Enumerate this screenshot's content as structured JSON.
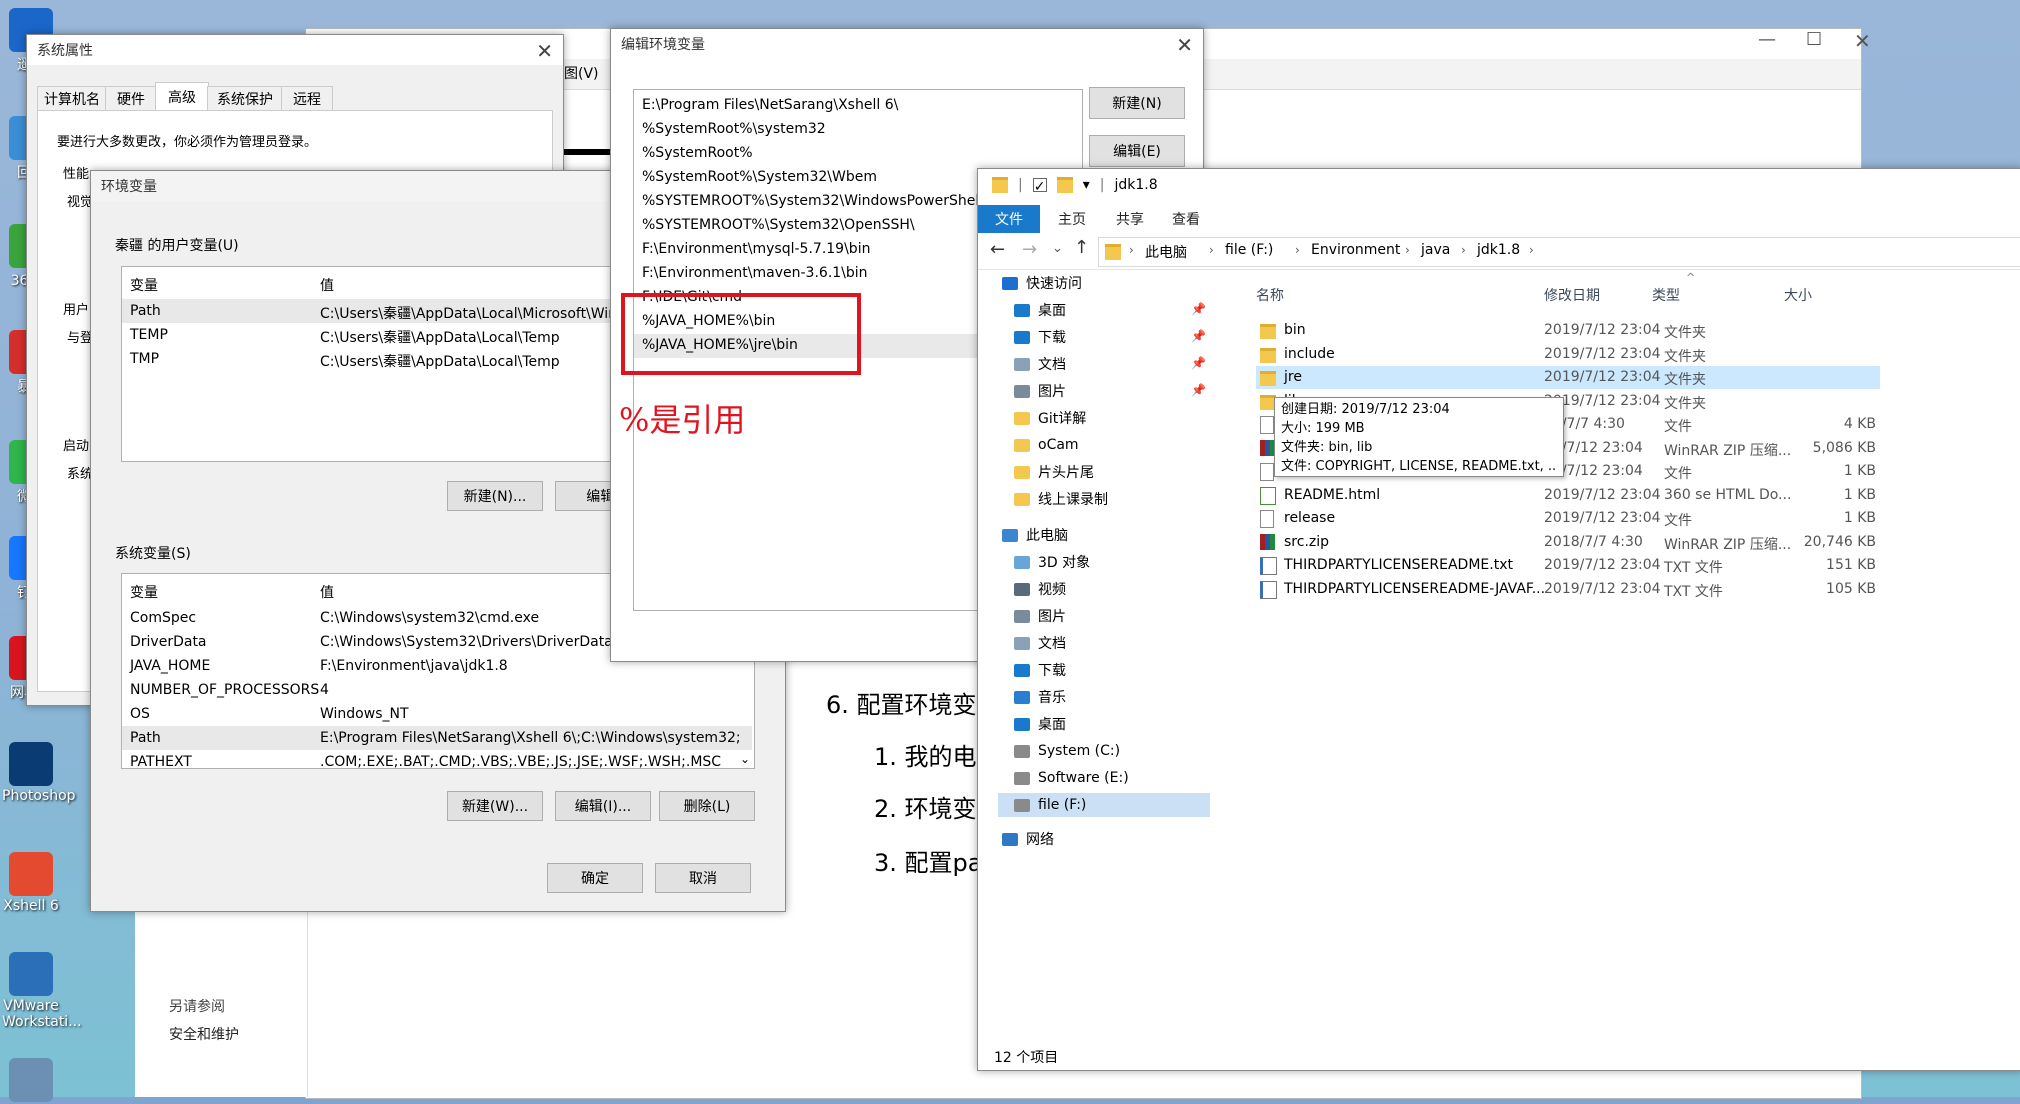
{
  "desktop": {
    "icons": [
      {
        "label": "遥控",
        "color": "#1b66c9"
      },
      {
        "label": "回收",
        "color": "#3b8ed6"
      },
      {
        "label": "360安",
        "color": "#3aa33c"
      },
      {
        "label": "暴风",
        "color": "#d62d2d"
      },
      {
        "label": "微信",
        "color": "#2fb54a"
      },
      {
        "label": "钉钉",
        "color": "#1677ff"
      },
      {
        "label": "网易云",
        "color": "#d8151f"
      },
      {
        "label": "Photoshop",
        "color": "#0b3b73"
      },
      {
        "label": "Xshell 6",
        "color": "#e34a2f"
      },
      {
        "label": "VMware Workstati...",
        "color": "#2a6fb7"
      },
      {
        "label": "",
        "color": "#6c8fb4"
      }
    ]
  },
  "sysprops": {
    "title": "系统属性",
    "tabs": [
      "计算机名",
      "硬件",
      "高级",
      "系统保护",
      "远程"
    ],
    "selected_tab": "高级",
    "admin_note": "要进行大多数更改，你必须作为管理员登录。",
    "perf_label": "性能",
    "perf_sub": "视觉",
    "user_label": "用户",
    "user_sub": "与登",
    "startup_label": "启动",
    "startup_sub": "系统"
  },
  "envvars": {
    "title": "环境变量",
    "user_group": "秦疆 的用户变量(U)",
    "col_var": "变量",
    "col_val": "值",
    "user_rows": [
      {
        "name": "Path",
        "value": "C:\\Users\\秦疆\\AppData\\Local\\Microsoft\\Windo"
      },
      {
        "name": "TEMP",
        "value": "C:\\Users\\秦疆\\AppData\\Local\\Temp"
      },
      {
        "name": "TMP",
        "value": "C:\\Users\\秦疆\\AppData\\Local\\Temp"
      }
    ],
    "user_new": "新建(N)...",
    "user_edit": "编辑(",
    "sys_group": "系统变量(S)",
    "sys_rows": [
      {
        "name": "ComSpec",
        "value": "C:\\Windows\\system32\\cmd.exe"
      },
      {
        "name": "DriverData",
        "value": "C:\\Windows\\System32\\Drivers\\DriverData"
      },
      {
        "name": "JAVA_HOME",
        "value": "F:\\Environment\\java\\jdk1.8"
      },
      {
        "name": "NUMBER_OF_PROCESSORS",
        "value": "4"
      },
      {
        "name": "OS",
        "value": "Windows_NT"
      },
      {
        "name": "Path",
        "value": "E:\\Program Files\\NetSarang\\Xshell 6\\;C:\\Windows\\system32;..."
      },
      {
        "name": "PATHEXT",
        "value": ".COM;.EXE;.BAT;.CMD;.VBS;.VBE;.JS;.JSE;.WSF;.WSH;.MSC"
      }
    ],
    "sys_new": "新建(W)...",
    "sys_edit": "编辑(I)...",
    "sys_delete": "删除(L)",
    "ok": "确定",
    "cancel": "取消"
  },
  "editenv": {
    "title": "编辑环境变量",
    "entries": [
      "E:\\Program Files\\NetSarang\\Xshell 6\\",
      "%SystemRoot%\\system32",
      "%SystemRoot%",
      "%SystemRoot%\\System32\\Wbem",
      "%SYSTEMROOT%\\System32\\WindowsPowerShell\\v",
      "%SYSTEMROOT%\\System32\\OpenSSH\\",
      "F:\\Environment\\mysql-5.7.19\\bin",
      "F:\\Environment\\maven-3.6.1\\bin",
      "F:\\IDE\\Git\\cmd",
      "%JAVA_HOME%\\bin",
      "%JAVA_HOME%\\jre\\bin"
    ],
    "new_btn": "新建(N)",
    "edit_btn": "编辑(E)",
    "annotation": "%是引用",
    "highlight_color": "#e0141e"
  },
  "bgdoc": {
    "menu_frag": "图(V)",
    "step_title": "6. 配置环境变",
    "steps": [
      "1. 我的电",
      "2. 环境变",
      "3. 配置pa"
    ],
    "see_also": "另请参阅",
    "security": "安全和维护"
  },
  "explorer": {
    "path_title": "jdk1.8",
    "ribbon_tabs": [
      "文件",
      "主页",
      "共享",
      "查看"
    ],
    "breadcrumb": [
      "此电脑",
      "file (F:)",
      "Environment",
      "java",
      "jdk1.8"
    ],
    "nav": [
      {
        "label": "快速访问",
        "icon": "star-icon",
        "pinned": false
      },
      {
        "label": "桌面",
        "icon": "desktop-icon",
        "pinned": true
      },
      {
        "label": "下载",
        "icon": "download-icon",
        "pinned": true
      },
      {
        "label": "文档",
        "icon": "document-icon",
        "pinned": true
      },
      {
        "label": "图片",
        "icon": "picture-icon",
        "pinned": true
      },
      {
        "label": "Git详解",
        "icon": "folder-icon",
        "pinned": false
      },
      {
        "label": "oCam",
        "icon": "folder-icon",
        "pinned": false
      },
      {
        "label": "片头片尾",
        "icon": "folder-icon",
        "pinned": false
      },
      {
        "label": "线上课录制",
        "icon": "folder-icon",
        "pinned": false
      },
      {
        "label": "此电脑",
        "icon": "computer-icon",
        "pinned": false
      },
      {
        "label": "3D 对象",
        "icon": "cube-icon",
        "pinned": false
      },
      {
        "label": "视频",
        "icon": "video-icon",
        "pinned": false
      },
      {
        "label": "图片",
        "icon": "picture-icon",
        "pinned": false
      },
      {
        "label": "文档",
        "icon": "document-icon",
        "pinned": false
      },
      {
        "label": "下载",
        "icon": "download-icon",
        "pinned": false
      },
      {
        "label": "音乐",
        "icon": "music-icon",
        "pinned": false
      },
      {
        "label": "桌面",
        "icon": "desktop-icon",
        "pinned": false
      },
      {
        "label": "System (C:)",
        "icon": "drive-icon",
        "pinned": false
      },
      {
        "label": "Software (E:)",
        "icon": "drive-icon",
        "pinned": false
      },
      {
        "label": "file (F:)",
        "icon": "drive-icon",
        "pinned": false
      },
      {
        "label": "网络",
        "icon": "network-icon",
        "pinned": false
      }
    ],
    "columns": [
      "名称",
      "修改日期",
      "类型",
      "大小"
    ],
    "files": [
      {
        "name": "bin",
        "date": "2019/7/12 23:04",
        "type": "文件夹",
        "size": "",
        "icon": "folder-icon"
      },
      {
        "name": "include",
        "date": "2019/7/12 23:04",
        "type": "文件夹",
        "size": "",
        "icon": "folder-icon"
      },
      {
        "name": "jre",
        "date": "2019/7/12 23:04",
        "type": "文件夹",
        "size": "",
        "icon": "folder-icon"
      },
      {
        "name": "lib",
        "date": "2019/7/12 23:04",
        "type": "文件夹",
        "size": "",
        "icon": "folder-icon"
      },
      {
        "name": "",
        "date": "18/7/7 4:30",
        "type": "文件",
        "size": "4 KB",
        "icon": "file-icon"
      },
      {
        "name": "",
        "date": "19/7/12 23:04",
        "type": "WinRAR ZIP 压缩...",
        "size": "5,086 KB",
        "icon": "archive-icon"
      },
      {
        "name": "",
        "date": "19/7/12 23:04",
        "type": "文件",
        "size": "1 KB",
        "icon": "file-icon"
      },
      {
        "name": "README.html",
        "date": "2019/7/12 23:04",
        "type": "360 se HTML Do...",
        "size": "1 KB",
        "icon": "html-icon"
      },
      {
        "name": "release",
        "date": "2019/7/12 23:04",
        "type": "文件",
        "size": "1 KB",
        "icon": "file-icon"
      },
      {
        "name": "src.zip",
        "date": "2018/7/7 4:30",
        "type": "WinRAR ZIP 压缩...",
        "size": "20,746 KB",
        "icon": "archive-icon"
      },
      {
        "name": "THIRDPARTYLICENSEREADME.txt",
        "date": "2019/7/12 23:04",
        "type": "TXT 文件",
        "size": "151 KB",
        "icon": "text-file-icon"
      },
      {
        "name": "THIRDPARTYLICENSEREADME-JAVAF...",
        "date": "2019/7/12 23:04",
        "type": "TXT 文件",
        "size": "105 KB",
        "icon": "text-file-icon"
      }
    ],
    "tooltip": [
      "创建日期: 2019/7/12 23:04",
      "大小: 199 MB",
      "文件夹: bin, lib",
      "文件: COPYRIGHT, LICENSE, README.txt, ..."
    ],
    "status": "12 个项目",
    "accent": "#1979ca"
  }
}
